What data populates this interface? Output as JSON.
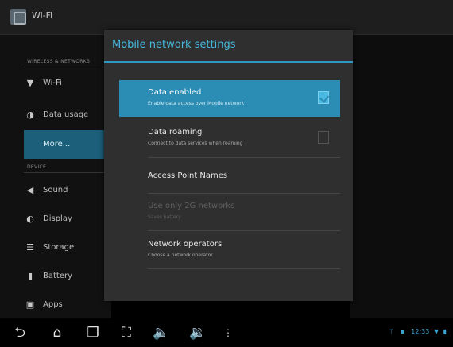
{
  "topbar": {
    "title": "Wi-Fi"
  },
  "sidebar": {
    "section_wireless": "WIRELESS & NETWORKS",
    "section_device": "DEVICE",
    "items": [
      {
        "label": "Wi-Fi",
        "icon": "wifi-icon"
      },
      {
        "label": "Data usage",
        "icon": "data-usage-icon"
      },
      {
        "label": "More...",
        "icon": ""
      },
      {
        "label": "Sound",
        "icon": "sound-icon"
      },
      {
        "label": "Display",
        "icon": "display-icon"
      },
      {
        "label": "Storage",
        "icon": "storage-icon"
      },
      {
        "label": "Battery",
        "icon": "battery-icon"
      },
      {
        "label": "Apps",
        "icon": "apps-icon"
      }
    ]
  },
  "dialog": {
    "title": "Mobile network settings",
    "options": [
      {
        "title": "Data enabled",
        "summary": "Enable data access over Mobile network",
        "checked": true
      },
      {
        "title": "Data roaming",
        "summary": "Connect to data services when roaming",
        "checked": false
      },
      {
        "title": "Access Point Names",
        "summary": ""
      },
      {
        "title": "Use only 2G networks",
        "summary": "Saves battery"
      },
      {
        "title": "Network operators",
        "summary": "Choose a network operator"
      }
    ]
  },
  "status": {
    "time": "12:33"
  },
  "colors": {
    "accent": "#2d98c2",
    "selected": "#2c8db4"
  }
}
